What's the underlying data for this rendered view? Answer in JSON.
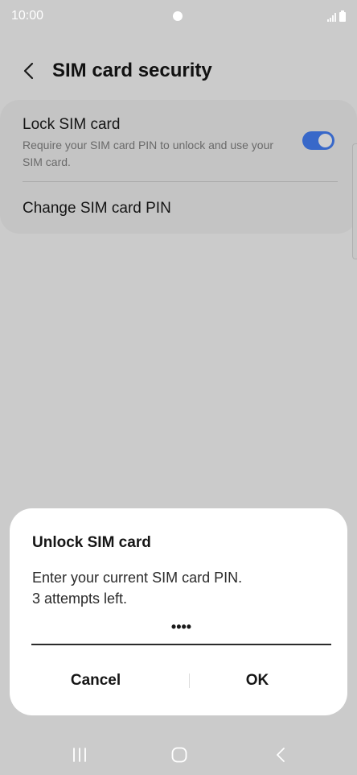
{
  "status_bar": {
    "time": "10:00"
  },
  "header": {
    "title": "SIM card security",
    "back_icon": "chevron-left-icon"
  },
  "settings": {
    "lock_sim": {
      "title": "Lock SIM card",
      "description": "Require your SIM card PIN to unlock and use your SIM card.",
      "enabled": true
    },
    "change_pin": {
      "title": "Change SIM card PIN"
    }
  },
  "dialog": {
    "title": "Unlock SIM card",
    "message_line1": "Enter your current SIM card PIN.",
    "message_line2": "3 attempts left.",
    "pin_value": "••••",
    "cancel_label": "Cancel",
    "ok_label": "OK"
  },
  "nav_bar": {
    "recents_icon": "recents-icon",
    "home_icon": "home-icon",
    "back_icon": "back-icon"
  },
  "colors": {
    "toggle_on": "#3868c9",
    "scrim_background": "#cbcbcb",
    "dialog_background": "#ffffff"
  }
}
